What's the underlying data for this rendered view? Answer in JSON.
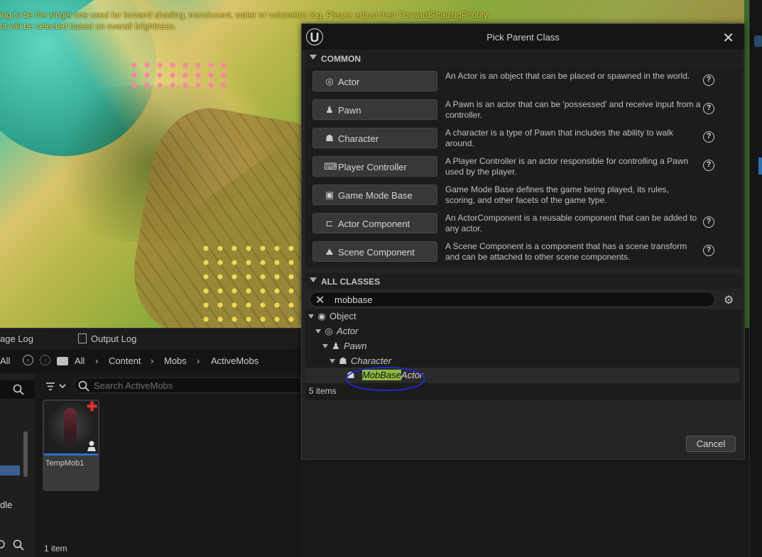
{
  "viewport": {
    "warning_line1": "ing to be the single one used for forward shading, translucent, water or volumetric fog. Please adjust their ForwardShadingPriority.",
    "warning_line2": "nt will be selected based on overall brightness."
  },
  "bottom_tabs": [
    {
      "label": "age Log"
    },
    {
      "label": "Output Log"
    }
  ],
  "breadcrumb": {
    "all_left": "All",
    "items": [
      "All",
      "Content",
      "Mobs",
      "ActiveMobs"
    ]
  },
  "content_browser": {
    "search_placeholder": "Search ActiveMobs",
    "left_item_partial": "dle",
    "assets": [
      {
        "name": "TempMob1"
      }
    ],
    "count": "1 item"
  },
  "dialog": {
    "title": "Pick Parent Class",
    "common_header": "COMMON",
    "all_classes_header": "ALL CLASSES",
    "common": [
      {
        "label": "Actor",
        "icon": "actor-icon",
        "description": "An Actor is an object that can be placed or spawned in the world.",
        "help": true
      },
      {
        "label": "Pawn",
        "icon": "pawn-icon",
        "description": "A Pawn is an actor that can be 'possessed' and receive input from a controller.",
        "help": true
      },
      {
        "label": "Character",
        "icon": "character-icon",
        "description": "A character is a type of Pawn that includes the ability to walk around.",
        "help": true
      },
      {
        "label": "Player Controller",
        "icon": "gamepad-icon",
        "description": "A Player Controller is an actor responsible for controlling a Pawn used by the player.",
        "help": true
      },
      {
        "label": "Game Mode Base",
        "icon": "game-mode-icon",
        "description": "Game Mode Base defines the game being played, its rules, scoring, and other facets of the game type.",
        "help": false
      },
      {
        "label": "Actor Component",
        "icon": "actor-component-icon",
        "description": "An ActorComponent is a reusable component that can be added to any actor.",
        "help": true
      },
      {
        "label": "Scene Component",
        "icon": "scene-component-icon",
        "description": "A Scene Component is a component that has a scene transform and can be attached to other scene components.",
        "help": true
      }
    ],
    "search_value": "mobbase",
    "tree": [
      {
        "label": "Object"
      },
      {
        "label": "Actor"
      },
      {
        "label": "Pawn"
      },
      {
        "label": "Character"
      },
      {
        "label_highlight": "MobBase",
        "label_rest": "Actor"
      }
    ],
    "items_count": "5 items",
    "cancel_label": "Cancel",
    "help_glyph": "?"
  },
  "colors": {
    "accent_blue": "#2f6fd1",
    "highlight_green": "#8fbb3f",
    "annotation_circle": "#1f2cc9",
    "warning_text": "#e8d23e"
  }
}
